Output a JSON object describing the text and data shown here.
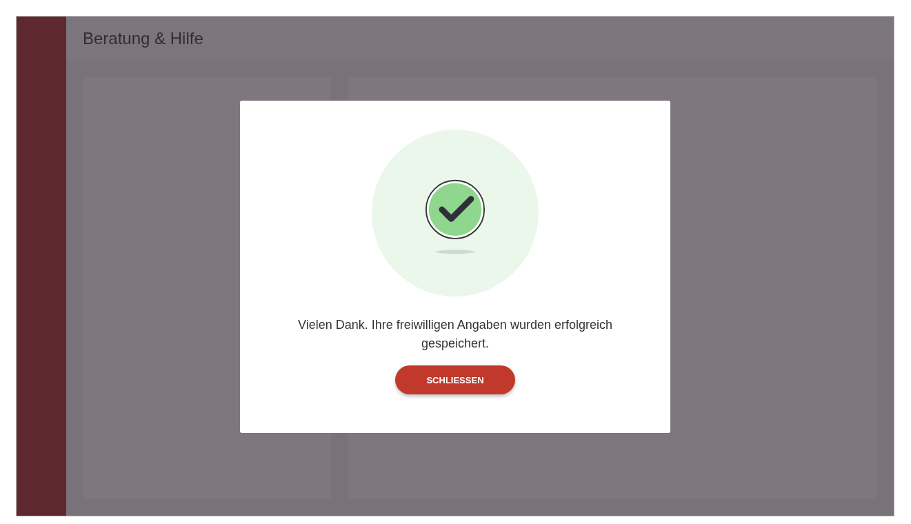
{
  "app": {
    "title": "Beratung & Hilfe"
  },
  "dialog": {
    "message": "Vielen Dank. Ihre freiwilligen Angaben wurden erfolgreich gespeichert.",
    "button": "SCHLIESSEN"
  }
}
